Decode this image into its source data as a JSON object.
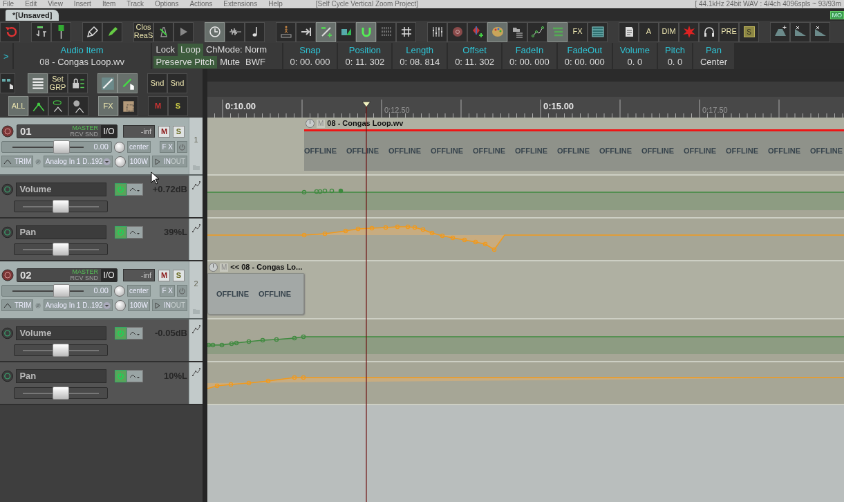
{
  "menu": [
    "File",
    "Edit",
    "View",
    "Insert",
    "Item",
    "Track",
    "Options",
    "Actions",
    "Extensions",
    "Help"
  ],
  "window": {
    "title": "[Self Cycle Vertical Zoom Project]",
    "status": "[ 44.1kHz 24bit WAV : 4/4ch 4096spls ~ 93/93m"
  },
  "tabs": [
    {
      "label": "*[Unsaved]",
      "selected": true
    }
  ],
  "mode_badge": "MO",
  "toolbar": [
    [
      {
        "kind": "icon",
        "on": false
      }
    ],
    [
      {
        "kind": "icon",
        "on": false
      },
      {
        "kind": "icon",
        "on": false
      }
    ],
    [
      {
        "kind": "icon",
        "on": false
      },
      {
        "kind": "icon",
        "on": false
      }
    ],
    [
      {
        "kind": "text",
        "label": "Clos ReaS",
        "on": false
      },
      {
        "kind": "icon",
        "on": false
      },
      {
        "kind": "icon",
        "on": false
      }
    ],
    [
      {
        "kind": "icon",
        "on": true
      },
      {
        "kind": "icon",
        "on": false
      },
      {
        "kind": "icon",
        "on": false
      }
    ],
    [
      {
        "kind": "icon",
        "on": false
      },
      {
        "kind": "icon",
        "on": false
      },
      {
        "kind": "icon",
        "on": true
      },
      {
        "kind": "icon",
        "on": false
      },
      {
        "kind": "icon",
        "on": true
      },
      {
        "kind": "icon",
        "on": false
      },
      {
        "kind": "icon",
        "on": false
      }
    ],
    [
      {
        "kind": "icon",
        "on": false
      },
      {
        "kind": "icon",
        "on": false
      },
      {
        "kind": "icon",
        "on": false
      },
      {
        "kind": "icon",
        "on": true
      },
      {
        "kind": "icon",
        "on": false
      },
      {
        "kind": "icon",
        "on": false
      },
      {
        "kind": "icon",
        "on": true
      },
      {
        "kind": "text",
        "label": "FX",
        "on": false
      },
      {
        "kind": "icon",
        "on": false
      }
    ],
    [
      {
        "kind": "icon",
        "on": false
      },
      {
        "kind": "text",
        "label": "A",
        "on": false
      },
      {
        "kind": "text",
        "label": "DIM",
        "on": false
      },
      {
        "kind": "icon",
        "on": false
      },
      {
        "kind": "icon",
        "on": false
      },
      {
        "kind": "text",
        "label": "PRE",
        "on": false
      },
      {
        "kind": "swatch",
        "label": "S",
        "on": false
      }
    ],
    [
      {
        "kind": "icon",
        "on": false
      },
      {
        "kind": "icon",
        "on": false
      },
      {
        "kind": "icon",
        "on": false
      }
    ]
  ],
  "item_info": {
    "expander": ">",
    "name_label": "Audio Item",
    "name": "08 - Congas Loop.wv",
    "flags": [
      {
        "label": "Lock",
        "on": false
      },
      {
        "label": "Loop",
        "on": true
      },
      {
        "label": "ChMode: Norm",
        "on": false
      },
      {
        "label": "Preserve Pitch",
        "on": true
      },
      {
        "label": "Mute",
        "on": false
      },
      {
        "label": "BWF",
        "on": false
      }
    ],
    "fields": [
      {
        "label": "Snap",
        "value": "0: 00. 000"
      },
      {
        "label": "Position",
        "value": "0: 11. 302"
      },
      {
        "label": "Length",
        "value": "0: 08. 814"
      },
      {
        "label": "Offset",
        "value": "0: 11. 302"
      },
      {
        "label": "FadeIn",
        "value": "0: 00. 000"
      },
      {
        "label": "FadeOut",
        "value": "0: 00. 000"
      },
      {
        "label": "Volume",
        "value": "0. 0"
      },
      {
        "label": "Pitch",
        "value": "0. 0"
      },
      {
        "label": "Pan",
        "value": "Center"
      }
    ]
  },
  "track_toolbar": [
    [
      {
        "kind": "icon",
        "on": false
      },
      {
        "kind": "icon",
        "on": true
      },
      {
        "kind": "text",
        "label": "Set GRP",
        "on": false
      },
      {
        "kind": "icon",
        "on": false
      },
      {
        "kind": "icon",
        "on": true
      },
      {
        "kind": "icon",
        "on": true
      },
      {
        "kind": "text",
        "label": "Snd",
        "on": false
      },
      {
        "kind": "text",
        "label": "Snd",
        "on": false
      }
    ],
    [
      {
        "kind": "text",
        "label": "ALL",
        "on": true
      },
      {
        "kind": "icon",
        "on": false
      },
      {
        "kind": "icon",
        "on": false
      },
      {
        "kind": "icon",
        "on": false
      },
      {
        "kind": "text",
        "label": "FX",
        "on": true
      },
      {
        "kind": "icon",
        "on": false
      },
      {
        "kind": "text",
        "label": "M",
        "on": false
      },
      {
        "kind": "text",
        "label": "S",
        "on": false
      }
    ]
  ],
  "ruler": [
    {
      "text": "0:10.00",
      "major": true
    },
    {
      "text": "0:12.50",
      "major": false
    },
    {
      "text": "0:15.00",
      "major": true
    },
    {
      "text": "0:17.50",
      "major": false
    }
  ],
  "tracks": [
    {
      "name": "01",
      "number": "1",
      "master": "MASTER",
      "routing": "RCV SND",
      "io": "I/O",
      "meter": "-inf",
      "mute": "M",
      "solo": "S",
      "volume": "0.00",
      "level": 0.55,
      "pan": "center",
      "fx": "F X",
      "trim": "TRIM",
      "input": "Analog In 1 D..192",
      "width": "100W",
      "monitor_in": "IN",
      "monitor_out": "OUT",
      "envelopes": [
        {
          "name": "Volume",
          "value": "+0.72dB",
          "level": 0.5
        },
        {
          "name": "Pan",
          "value": "39%L",
          "level": 0.5
        }
      ],
      "item": {
        "title": "08 - Congas Loop.wv",
        "mute": "M",
        "selected": true,
        "offline": [
          "OFFLINE",
          "OFFLINE",
          "OFFLINE",
          "OFFLINE",
          "OFFLINE",
          "OFFLINE",
          "OFFLINE",
          "OFFLINE",
          "OFFLINE",
          "OFFLINE",
          "OFFLINE",
          "OFFLINE",
          "OFFLINE"
        ]
      }
    },
    {
      "name": "02",
      "number": "2",
      "master": "MASTER",
      "routing": "RCV SND",
      "io": "I/O",
      "meter": "-inf",
      "mute": "M",
      "solo": "S",
      "volume": "0.00",
      "level": 0.55,
      "pan": "center",
      "fx": "F X",
      "trim": "TRIM",
      "input": "Analog In 1 D..192",
      "width": "100W",
      "monitor_in": "IN",
      "monitor_out": "OUT",
      "envelopes": [
        {
          "name": "Volume",
          "value": "-0.05dB",
          "level": 0.5
        },
        {
          "name": "Pan",
          "value": "10%L",
          "level": 0.5
        }
      ],
      "item": {
        "title": "<< 08 - Congas Lo...",
        "mute": "M",
        "selected": false,
        "offline": [
          "OFFLINE",
          "OFFLINE"
        ]
      }
    }
  ]
}
